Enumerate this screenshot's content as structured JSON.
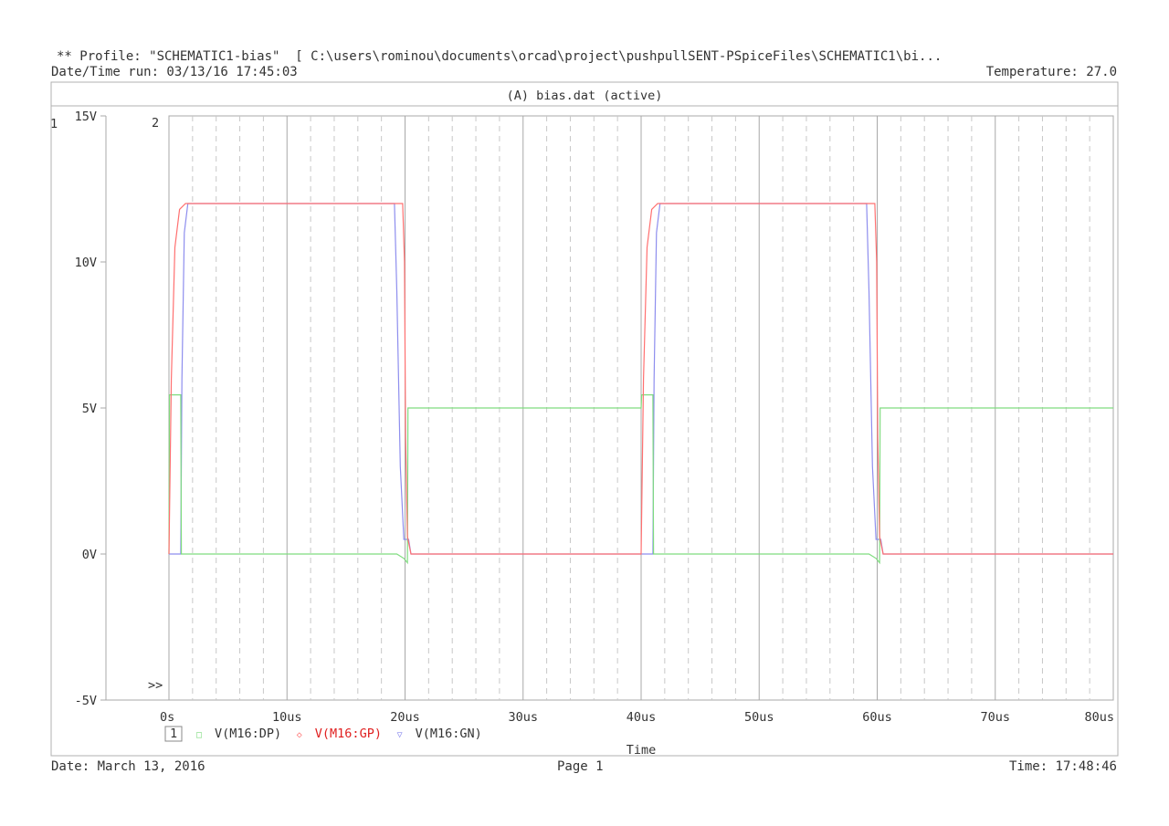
{
  "header": {
    "profile": "** Profile: \"SCHEMATIC1-bias\"  [ C:\\users\\rominou\\documents\\orcad\\project\\pushpullSENT-PSpiceFiles\\SCHEMATIC1\\bi...",
    "datetime_run": "Date/Time run: 03/13/16 17:45:03",
    "temperature": "Temperature: 27.0"
  },
  "plot": {
    "title": "(A) bias.dat (active)",
    "axis1_label": "1",
    "axis2_label": "2",
    "marker": ">>"
  },
  "footer": {
    "date": "Date: March 13, 2016",
    "page": "Page 1",
    "time": "Time: 17:48:46"
  },
  "colors": {
    "dp": "#7fdc7f",
    "gp": "#ff7070",
    "gn": "#8e8eee",
    "legend_gp_text": "#e02020",
    "grid_major": "#a8a8a8",
    "grid_minor": "#c8c8c8"
  },
  "chart_data": {
    "type": "line",
    "xlabel": "Time",
    "xlim": [
      0,
      80
    ],
    "x_unit": "us",
    "ylim": [
      -5,
      15
    ],
    "x_ticks": [
      "0s",
      "10us",
      "20us",
      "30us",
      "40us",
      "50us",
      "60us",
      "70us",
      "80us"
    ],
    "x_tick_values": [
      0,
      10,
      20,
      30,
      40,
      50,
      60,
      70,
      80
    ],
    "y_ticks": [
      "15V",
      "10V",
      "5V",
      "0V",
      "-5V"
    ],
    "y_tick_values": [
      15,
      10,
      5,
      0,
      -5
    ],
    "grid": true,
    "legend_axis_id": "1",
    "legend_position": "bottom-left",
    "series": [
      {
        "name": "V(M16:DP)",
        "symbol": "□",
        "color_key": "dp",
        "points": [
          [
            0,
            0
          ],
          [
            0.05,
            5.45
          ],
          [
            1.0,
            5.45
          ],
          [
            1.05,
            0
          ],
          [
            19.3,
            0
          ],
          [
            19.9,
            -0.15
          ],
          [
            20.2,
            -0.3
          ],
          [
            20.25,
            5
          ],
          [
            40.0,
            5
          ],
          [
            40.05,
            5.45
          ],
          [
            41.0,
            5.45
          ],
          [
            41.05,
            0
          ],
          [
            59.3,
            0
          ],
          [
            59.9,
            -0.15
          ],
          [
            60.2,
            -0.3
          ],
          [
            60.25,
            5
          ],
          [
            80,
            5
          ]
        ]
      },
      {
        "name": "V(M16:GP)",
        "symbol": "◇",
        "color_key": "gp",
        "points": [
          [
            0,
            0
          ],
          [
            0.2,
            6
          ],
          [
            0.5,
            10.5
          ],
          [
            0.9,
            11.8
          ],
          [
            1.4,
            12
          ],
          [
            19.8,
            12
          ],
          [
            19.95,
            10
          ],
          [
            20.05,
            4
          ],
          [
            20.2,
            0.6
          ],
          [
            20.5,
            0
          ],
          [
            40.0,
            0
          ],
          [
            40.2,
            6
          ],
          [
            40.5,
            10.5
          ],
          [
            40.9,
            11.8
          ],
          [
            41.4,
            12
          ],
          [
            59.8,
            12
          ],
          [
            59.95,
            10
          ],
          [
            60.05,
            4
          ],
          [
            60.2,
            0.6
          ],
          [
            60.5,
            0
          ],
          [
            80,
            0
          ]
        ]
      },
      {
        "name": "V(M16:GN)",
        "symbol": "▽",
        "color_key": "gn",
        "points": [
          [
            0,
            0
          ],
          [
            1.0,
            0
          ],
          [
            1.1,
            6
          ],
          [
            1.3,
            11
          ],
          [
            1.6,
            12
          ],
          [
            19.1,
            12
          ],
          [
            19.3,
            9
          ],
          [
            19.6,
            3
          ],
          [
            19.9,
            0.5
          ],
          [
            20.3,
            0.5
          ],
          [
            20.5,
            0
          ],
          [
            40.0,
            0
          ],
          [
            41.0,
            0
          ],
          [
            41.1,
            6
          ],
          [
            41.3,
            11
          ],
          [
            41.6,
            12
          ],
          [
            59.1,
            12
          ],
          [
            59.3,
            9
          ],
          [
            59.6,
            3
          ],
          [
            59.9,
            0.5
          ],
          [
            60.3,
            0.5
          ],
          [
            60.5,
            0
          ],
          [
            80,
            0
          ]
        ]
      }
    ]
  }
}
